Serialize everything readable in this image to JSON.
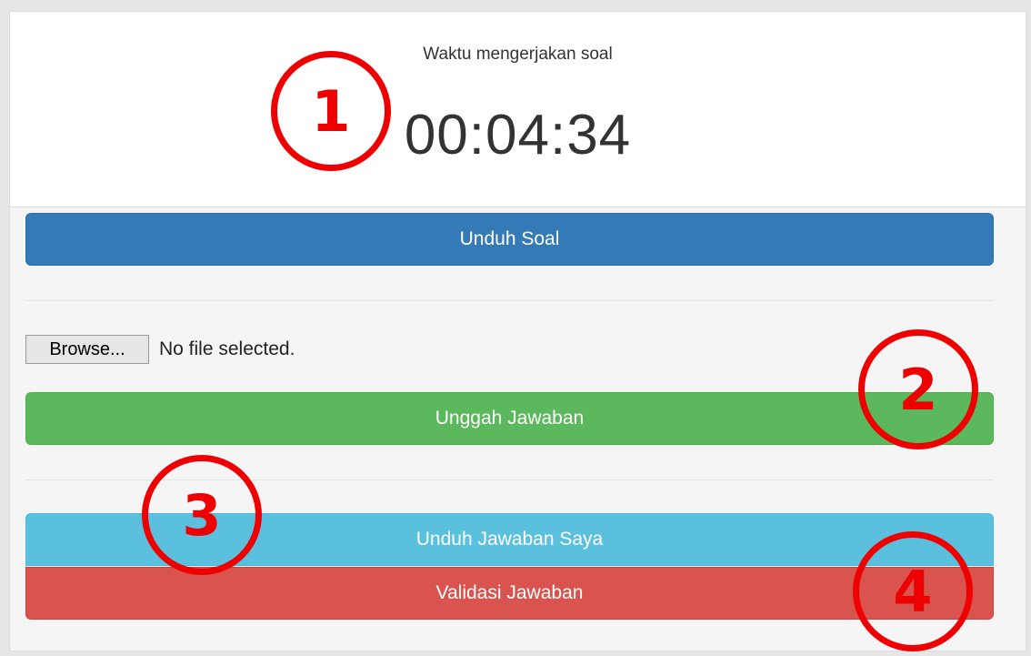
{
  "timer": {
    "label": "Waktu mengerjakan soal",
    "value": "00:04:34"
  },
  "buttons": {
    "download_question": "Unduh Soal",
    "upload_answer": "Unggah Jawaban",
    "download_my_answer": "Unduh Jawaban Saya",
    "validate_answer": "Validasi Jawaban"
  },
  "file_input": {
    "browse_label": "Browse...",
    "status": "No file selected."
  },
  "markers": [
    "1",
    "2",
    "3",
    "4"
  ],
  "colors": {
    "primary": "#337ab7",
    "success": "#5cb85c",
    "info": "#5bc0de",
    "danger": "#d9534f",
    "marker": "#ee0000"
  }
}
